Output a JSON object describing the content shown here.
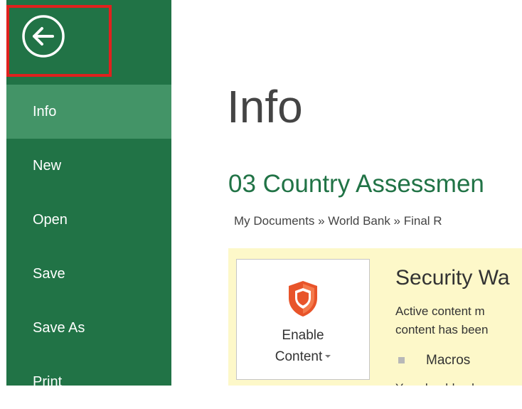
{
  "sidebar": {
    "items": [
      {
        "label": "Info",
        "active": true
      },
      {
        "label": "New"
      },
      {
        "label": "Open"
      },
      {
        "label": "Save"
      },
      {
        "label": "Save As"
      },
      {
        "label": "Print"
      }
    ]
  },
  "colors": {
    "sidebar_bg": "#217346",
    "sidebar_active": "#439467",
    "highlight_border": "#e0211e",
    "accent_green": "#217346",
    "security_bar_bg": "#fdf8c9",
    "shield_orange": "#e8542a"
  },
  "icons": {
    "back": "back-arrow-circle-icon",
    "shield": "shield-icon"
  },
  "main": {
    "title": "Info",
    "document_title": "03 Country Assessmen",
    "breadcrumb": "My Documents » World Bank » Final R"
  },
  "security": {
    "title": "Security Wa",
    "desc_line1": "Active content m",
    "desc_line2": "content has been",
    "enable_line1": "Enable",
    "enable_line2": "Content",
    "bullet": "Macros",
    "cut_text": "You should only"
  }
}
